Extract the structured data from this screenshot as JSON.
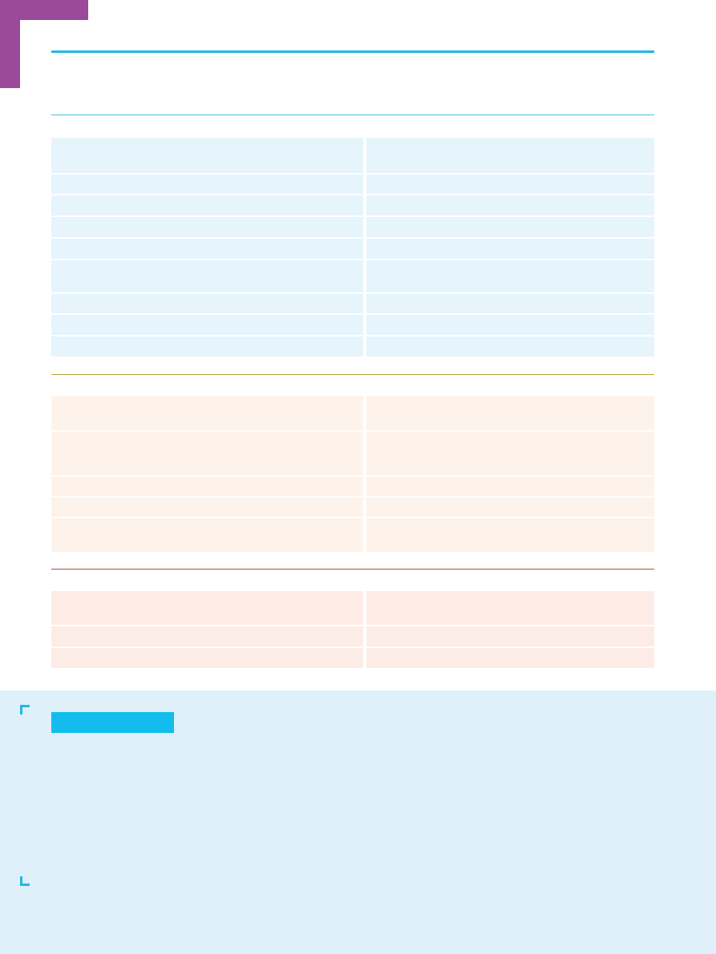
{
  "page": {
    "title": "",
    "colors": {
      "accent_purple": "#9a4a98",
      "accent_cyan": "#1fb8e6",
      "section_blue_fill": "#e6f4fc",
      "section_orange_fill": "#fef3ea",
      "section_red_fill": "#fdece5",
      "rule_olive": "#b5a53f",
      "rule_red": "#c0463b",
      "panel_fill": "#dff0fb"
    }
  },
  "table_blue": {
    "rows": [
      {
        "left": "",
        "right": ""
      },
      {
        "left": "",
        "right": ""
      },
      {
        "left": "",
        "right": ""
      },
      {
        "left": "",
        "right": ""
      },
      {
        "left": "",
        "right": ""
      },
      {
        "left": "",
        "right": ""
      },
      {
        "left": "",
        "right": ""
      },
      {
        "left": "",
        "right": ""
      },
      {
        "left": "",
        "right": ""
      }
    ]
  },
  "table_orange": {
    "rows": [
      {
        "left": "",
        "right": ""
      },
      {
        "left": "",
        "right": ""
      },
      {
        "left": "",
        "right": ""
      },
      {
        "left": "",
        "right": ""
      },
      {
        "left": "",
        "right": ""
      }
    ]
  },
  "table_red": {
    "rows": [
      {
        "left": "",
        "right": ""
      },
      {
        "left": "",
        "right": ""
      },
      {
        "left": "",
        "right": ""
      }
    ]
  },
  "bottom_panel": {
    "label": ""
  }
}
